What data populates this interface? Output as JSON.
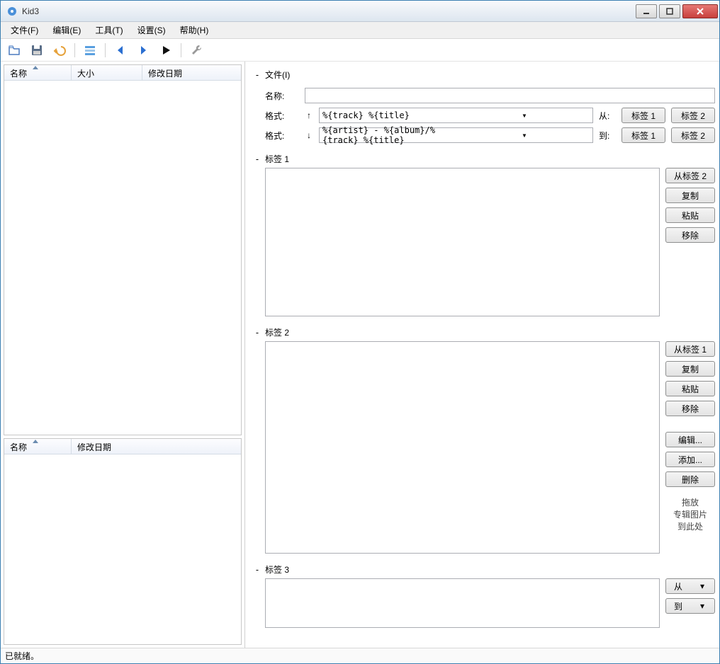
{
  "window": {
    "title": "Kid3"
  },
  "menu": {
    "file": "文件(F)",
    "edit": "编辑(E)",
    "tools": "工具(T)",
    "settings": "设置(S)",
    "help": "帮助(H)"
  },
  "toolbar_icons": {
    "open": "open-icon",
    "save": "save-icon",
    "undo": "undo-icon",
    "list": "list-icon",
    "prev": "prev-icon",
    "next": "next-icon",
    "play": "play-icon",
    "wrench": "wrench-icon"
  },
  "left": {
    "cols1": {
      "name": "名称",
      "size": "大小",
      "date": "修改日期"
    },
    "cols2": {
      "name": "名称",
      "date": "修改日期"
    }
  },
  "file_section": {
    "title": "文件(I)",
    "name_label": "名称:",
    "name_value": "",
    "fmt_label": "格式:",
    "fmt_from_value": "%{track} %{title}",
    "fmt_to_value": "%{artist} - %{album}/%{track} %{title}",
    "from_label": "从:",
    "to_label": "到:",
    "tag1_btn": "标签 1",
    "tag2_btn": "标签 2"
  },
  "tag1": {
    "title": "标签 1",
    "from_tag2": "从标签 2",
    "copy": "复制",
    "paste": "粘贴",
    "remove": "移除"
  },
  "tag2": {
    "title": "标签 2",
    "from_tag1": "从标签 1",
    "copy": "复制",
    "paste": "粘贴",
    "remove": "移除",
    "edit": "编辑...",
    "add": "添加...",
    "delete": "删除",
    "drop1": "拖放",
    "drop2": "专辑图片",
    "drop3": "到此处"
  },
  "tag3": {
    "title": "标签 3",
    "from": "从",
    "to": "到"
  },
  "status": "已就绪。"
}
